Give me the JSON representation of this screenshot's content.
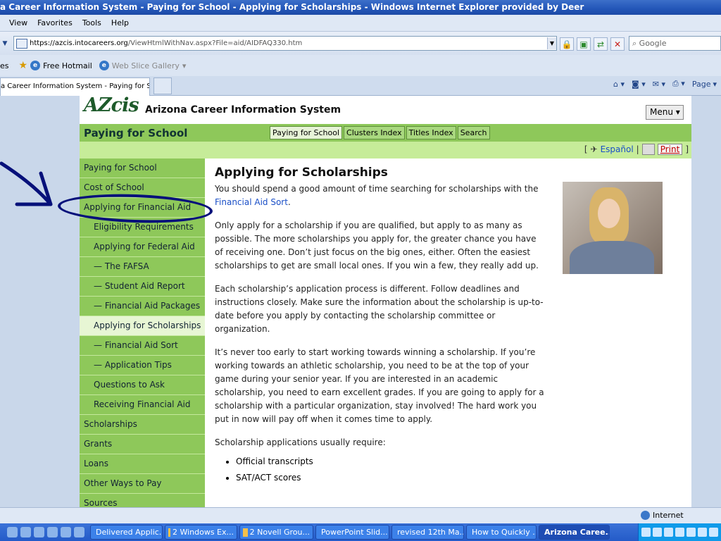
{
  "window": {
    "title": "a Career Information System - Paying for School - Applying for Scholarships - Windows Internet Explorer provided by Deer"
  },
  "menubar": [
    "View",
    "Favorites",
    "Tools",
    "Help"
  ],
  "address": {
    "url_host": "https://azcis.intocareers.org",
    "url_path": "/ViewHtmlWithNav.aspx?File=aid/AIDFAQ330.htm",
    "search_placeholder": "Google"
  },
  "favorites": {
    "label": "es",
    "items": [
      "Free Hotmail",
      "Web Slice Gallery"
    ]
  },
  "tab": {
    "label": "a Career Information System - Paying for Scho..."
  },
  "commandbar": {
    "page": "Page"
  },
  "site": {
    "logo": "AZcis",
    "title": "Arizona Career Information System",
    "menu": "Menu",
    "section": "Paying for School",
    "subnav": [
      "Paying for School",
      "Clusters Index",
      "Titles Index",
      "Search"
    ],
    "espanol": "Español",
    "print": "Print"
  },
  "sidebar": [
    {
      "label": "Paying for School",
      "level": 1
    },
    {
      "label": "Cost of School",
      "level": 1
    },
    {
      "label": "Applying for Financial Aid",
      "level": 1
    },
    {
      "label": "Eligibility Requirements",
      "level": 2
    },
    {
      "label": "Applying for Federal Aid",
      "level": 2
    },
    {
      "label": "— The FAFSA",
      "level": 3
    },
    {
      "label": "— Student Aid Report",
      "level": 3
    },
    {
      "label": "— Financial Aid Packages",
      "level": 3
    },
    {
      "label": "Applying for Scholarships",
      "level": 2,
      "active": true
    },
    {
      "label": "— Financial Aid Sort",
      "level": 3
    },
    {
      "label": "— Application Tips",
      "level": 3
    },
    {
      "label": "Questions to Ask",
      "level": 2
    },
    {
      "label": "Receiving Financial Aid",
      "level": 2
    },
    {
      "label": "Scholarships",
      "level": 1
    },
    {
      "label": "Grants",
      "level": 1
    },
    {
      "label": "Loans",
      "level": 1
    },
    {
      "label": "Other Ways to Pay",
      "level": 1
    },
    {
      "label": "Sources",
      "level": 1
    }
  ],
  "article": {
    "heading": "Applying for Scholarships",
    "p1_pre": "You should spend a good amount of time searching for scholarships with the ",
    "p1_link": "Financial Aid Sort",
    "p1_post": ".",
    "p2": "Only apply for a scholarship if you are qualified, but apply to as many as possible. The more scholarships you apply for, the greater chance you have of receiving one. Don’t just focus on the big ones, either. Often the easiest scholarships to get are small local ones. If you win a few, they really add up.",
    "p3": "Each scholarship’s application process is different. Follow deadlines and instructions closely. Make sure the information about the scholarship is up-to-date before you apply by contacting the scholarship committee or organization.",
    "p4": "It’s never too early to start working towards winning a scholarship. If you’re working towards an athletic scholarship, you need to be at the top of your game during your senior year. If you are interested in an academic scholarship, you need to earn excellent grades. If you are going to apply for a scholarship with a particular organization, stay involved! The hard work you put in now will pay off when it comes time to apply.",
    "p5": "Scholarship applications usually require:",
    "bullets": [
      "Official transcripts",
      "SAT/ACT scores"
    ]
  },
  "status": {
    "zone": "Internet"
  },
  "taskbar": [
    {
      "label": "Delivered Applic...",
      "active": false
    },
    {
      "label": "2 Windows Ex...",
      "active": false
    },
    {
      "label": "2 Novell Grou...",
      "active": false
    },
    {
      "label": "PowerPoint Slid...",
      "active": false
    },
    {
      "label": "revised 12th Ma...",
      "active": false
    },
    {
      "label": "How to Quickly ...",
      "active": false
    },
    {
      "label": "Arizona Caree...",
      "active": true
    }
  ],
  "colors": {
    "site_green": "#8ec85a",
    "site_light_green": "#c6ec99",
    "annotation_ink": "#06107a",
    "link_blue": "#1a4fc7"
  }
}
